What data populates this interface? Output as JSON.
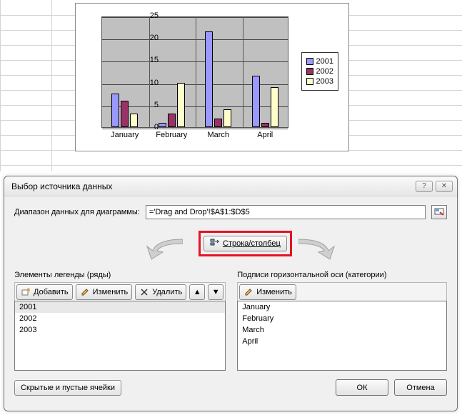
{
  "chart_data": {
    "type": "bar",
    "categories": [
      "January",
      "February",
      "March",
      "April"
    ],
    "series": [
      {
        "name": "2001",
        "color": "#9999ff",
        "values": [
          7.5,
          1,
          21.5,
          11.5
        ]
      },
      {
        "name": "2002",
        "color": "#993366",
        "values": [
          6,
          3,
          2,
          1
        ]
      },
      {
        "name": "2003",
        "color": "#ffffcc",
        "values": [
          3,
          10,
          4,
          9
        ]
      }
    ],
    "ylim": [
      0,
      25
    ],
    "yticks": [
      0,
      5,
      10,
      15,
      20,
      25
    ],
    "xlabel": "",
    "ylabel": "",
    "title": ""
  },
  "dialog": {
    "title": "Выбор источника данных",
    "range_label": "Диапазон данных для диаграммы:",
    "range_value": "='Drag and Drop'!$A$1:$D$5",
    "swap_button": "Строка/столбец",
    "legend_header": "Элементы легенды (ряды)",
    "axis_header": "Подписи горизонтальной оси (категории)",
    "buttons": {
      "add": "Добавить",
      "edit": "Изменить",
      "delete": "Удалить",
      "edit_axis": "Изменить",
      "hidden": "Скрытые и пустые ячейки",
      "ok": "ОК",
      "cancel": "Отмена"
    },
    "series_list": [
      "2001",
      "2002",
      "2003"
    ],
    "category_list": [
      "January",
      "February",
      "March",
      "April"
    ]
  }
}
